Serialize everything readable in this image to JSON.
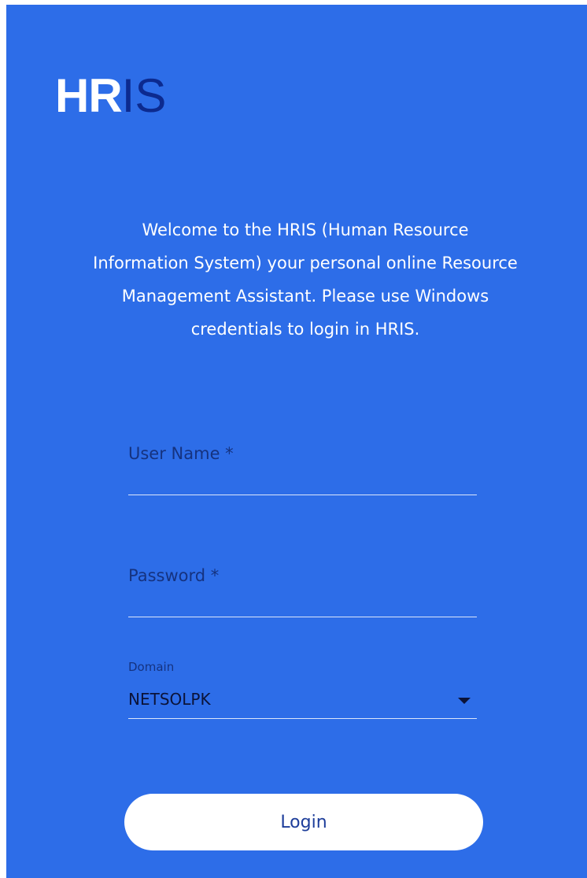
{
  "logo": {
    "part_white": "HR",
    "part_dark": "IS"
  },
  "welcome_text": "Welcome to the HRIS (Human Resource Information System) your personal online Resource Management Assistant. Please use Windows credentials to login in HRIS.",
  "form": {
    "username": {
      "placeholder": "User Name *",
      "value": ""
    },
    "password": {
      "placeholder": "Password *",
      "value": ""
    },
    "domain": {
      "label": "Domain",
      "selected": "NETSOLPK",
      "icon": "chevron-down-icon"
    },
    "login_label": "Login"
  },
  "colors": {
    "panel_bg": "#2d6de8",
    "logo_dark": "#0c2a8f",
    "button_bg": "#ffffff",
    "button_text": "#1d3d9a"
  }
}
